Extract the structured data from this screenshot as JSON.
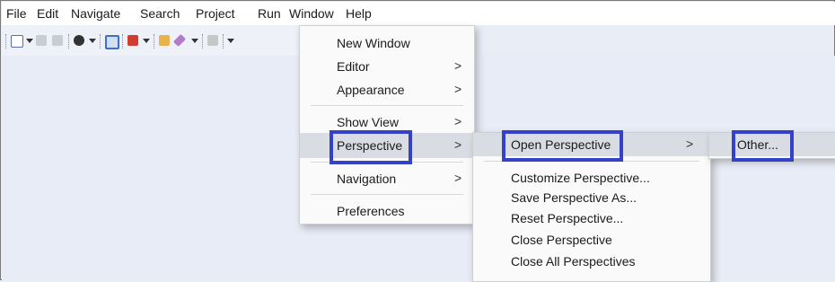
{
  "menubar": [
    "File",
    "Edit",
    "Navigate",
    "Search",
    "Project",
    "Run",
    "Window",
    "Help"
  ],
  "toolbar_icons": [
    "new-file-icon",
    "save-icon",
    "save-all-icon",
    "debug-icon",
    "terminal-icon",
    "run-icon",
    "open-folder-icon",
    "edit-pen-icon",
    "navigate-icon"
  ],
  "window_menu": {
    "new_window": "New Window",
    "editor": "Editor",
    "appearance": "Appearance",
    "show_view": "Show View",
    "perspective": "Perspective",
    "navigation": "Navigation",
    "preferences": "Preferences"
  },
  "perspective_menu": {
    "open": "Open Perspective",
    "customize": "Customize Perspective...",
    "save_as": "Save Perspective As...",
    "reset": "Reset Perspective...",
    "close": "Close Perspective",
    "close_all": "Close All Perspectives"
  },
  "open_perspective_menu": {
    "other": "Other..."
  },
  "submenu_arrow": ">",
  "colors": {
    "highlight_box": "#3342c9",
    "hover": "#d9dde3",
    "workspace": "#e8ecf6"
  }
}
